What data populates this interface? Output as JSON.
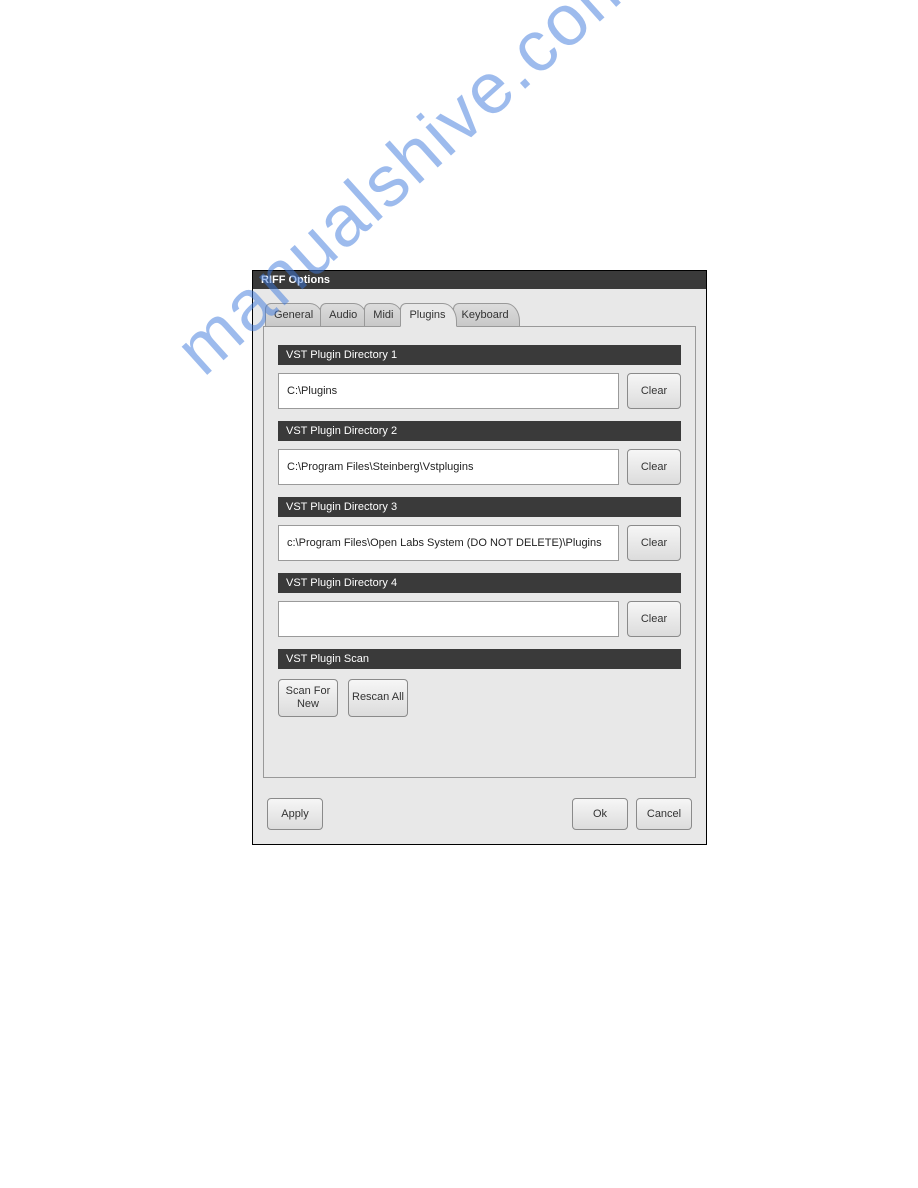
{
  "window": {
    "title": "RIFF Options"
  },
  "tabs": [
    {
      "label": "General",
      "active": false
    },
    {
      "label": "Audio",
      "active": false
    },
    {
      "label": "Midi",
      "active": false
    },
    {
      "label": "Plugins",
      "active": true
    },
    {
      "label": "Keyboard",
      "active": false
    }
  ],
  "sections": {
    "dir1": {
      "header": "VST Plugin Directory 1",
      "value": "C:\\Plugins",
      "clear": "Clear"
    },
    "dir2": {
      "header": "VST Plugin Directory 2",
      "value": "C:\\Program Files\\Steinberg\\Vstplugins",
      "clear": "Clear"
    },
    "dir3": {
      "header": "VST Plugin Directory 3",
      "value": "c:\\Program Files\\Open Labs System (DO NOT DELETE)\\Plugins",
      "clear": "Clear"
    },
    "dir4": {
      "header": "VST Plugin Directory 4",
      "value": "",
      "clear": "Clear"
    },
    "scan": {
      "header": "VST Plugin Scan",
      "scan_new": "Scan For New",
      "rescan": "Rescan All"
    }
  },
  "buttons": {
    "apply": "Apply",
    "ok": "Ok",
    "cancel": "Cancel"
  },
  "watermark": "manualshive.com"
}
